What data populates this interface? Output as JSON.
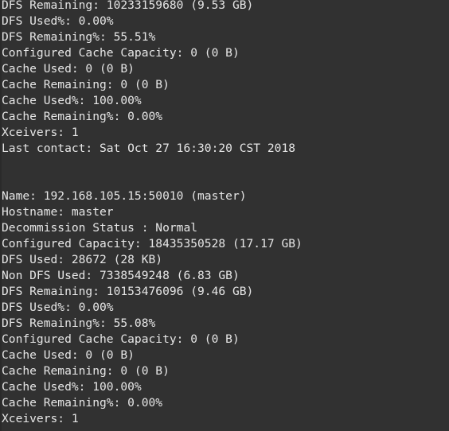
{
  "terminal": {
    "background_color": "#313131",
    "text_color": "#e6e6e6",
    "font_size_px": 14.6,
    "line_height_px": 20,
    "title": "hdfs dfsadmin -report output"
  },
  "output": {
    "lines": [
      "DFS Remaining: 10233159680 (9.53 GB)",
      "DFS Used%: 0.00%",
      "DFS Remaining%: 55.51%",
      "Configured Cache Capacity: 0 (0 B)",
      "Cache Used: 0 (0 B)",
      "Cache Remaining: 0 (0 B)",
      "Cache Used%: 100.00%",
      "Cache Remaining%: 0.00%",
      "Xceivers: 1",
      "Last contact: Sat Oct 27 16:30:20 CST 2018",
      "",
      "",
      "Name: 192.168.105.15:50010 (master)",
      "Hostname: master",
      "Decommission Status : Normal",
      "Configured Capacity: 18435350528 (17.17 GB)",
      "DFS Used: 28672 (28 KB)",
      "Non DFS Used: 7338549248 (6.83 GB)",
      "DFS Remaining: 10153476096 (9.46 GB)",
      "DFS Used%: 0.00%",
      "DFS Remaining%: 55.08%",
      "Configured Cache Capacity: 0 (0 B)",
      "Cache Used: 0 (0 B)",
      "Cache Remaining: 0 (0 B)",
      "Cache Used%: 100.00%",
      "Cache Remaining%: 0.00%",
      "Xceivers: 1"
    ]
  },
  "datanode_reports": [
    {
      "partial": true,
      "dfs_remaining": "10233159680 (9.53 GB)",
      "dfs_used_pct": "0.00%",
      "dfs_remaining_pct": "55.51%",
      "configured_cache_capacity": "0 (0 B)",
      "cache_used": "0 (0 B)",
      "cache_remaining": "0 (0 B)",
      "cache_used_pct": "100.00%",
      "cache_remaining_pct": "0.00%",
      "xceivers": "1",
      "last_contact": "Sat Oct 27 16:30:20 CST 2018"
    },
    {
      "partial": false,
      "name": "192.168.105.15:50010 (master)",
      "hostname": "master",
      "decommission_status": "Normal",
      "configured_capacity": "18435350528 (17.17 GB)",
      "dfs_used": "28672 (28 KB)",
      "non_dfs_used": "7338549248 (6.83 GB)",
      "dfs_remaining": "10153476096 (9.46 GB)",
      "dfs_used_pct": "0.00%",
      "dfs_remaining_pct": "55.08%",
      "configured_cache_capacity": "0 (0 B)",
      "cache_used": "0 (0 B)",
      "cache_remaining": "0 (0 B)",
      "cache_used_pct": "100.00%",
      "cache_remaining_pct": "0.00%",
      "xceivers": "1"
    }
  ]
}
